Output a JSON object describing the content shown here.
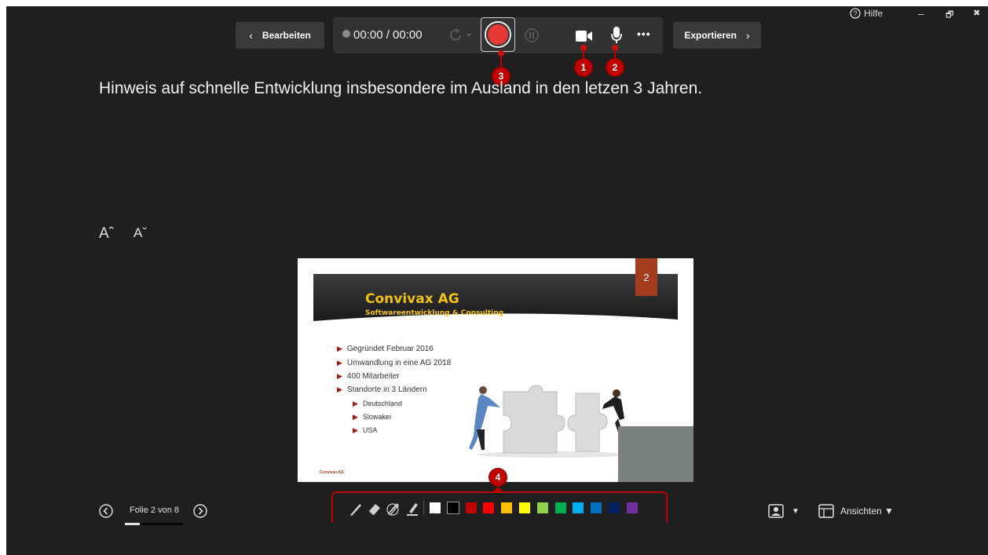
{
  "window": {
    "help_label": "Hilfe",
    "minimize_glyph": "–",
    "restore_glyph": "🗗",
    "close_glyph": "✖"
  },
  "toolbar": {
    "edit_label": "Bearbeiten",
    "timer": "00:00 / 00:00",
    "export_label": "Exportieren",
    "more_glyph": "•••"
  },
  "callouts": {
    "c1": "1",
    "c2": "2",
    "c3": "3",
    "c4": "4"
  },
  "notes": {
    "text": "Hinweis auf schnelle Entwicklung insbesondere im Ausland in den letzen 3 Jahren.",
    "font_increase": "Aˆ",
    "font_decrease": "Aˇ"
  },
  "slide": {
    "number": "2",
    "company": "Convivax AG",
    "tagline": "Softwareentwicklung & Consulting",
    "bullets": [
      "Gegründet Februar 2016",
      "Umwandlung in eine AG 2018",
      "400 Mitarbeiter",
      "Standorte in 3 Ländern"
    ],
    "sub_bullets": [
      "Deutschland",
      "Slowakei",
      "USA"
    ],
    "footer": "Convivax AG"
  },
  "navigation": {
    "slide_counter": "Folie 2 von 8",
    "progress_fraction": 0.25
  },
  "ink_colors": [
    "#ffffff",
    "#000000",
    "#c00000",
    "#ff0000",
    "#ffc000",
    "#ffff00",
    "#92d050",
    "#00b050",
    "#00b0f0",
    "#0070c0",
    "#002060",
    "#7030a0"
  ],
  "view": {
    "views_label": "Ansichten ▼",
    "camera_arrow": "▼"
  },
  "colors": {
    "record_red": "#e53935",
    "callout_red": "#c00000"
  }
}
